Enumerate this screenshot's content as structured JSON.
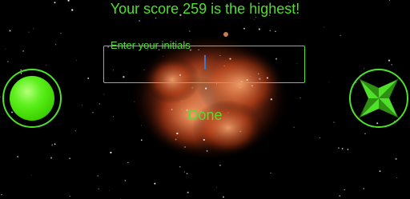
{
  "score_banner": "Your score 259 is the highest!",
  "initials_field": {
    "label": "Enter your initials",
    "value": ""
  },
  "done_label": "Done",
  "controls": {
    "fire_icon": "green-orb-icon",
    "nav_icon": "four-arrow-dpad-icon"
  },
  "colors": {
    "accent": "#4fe02a",
    "background": "#000000",
    "nebula": "#e8643a"
  }
}
